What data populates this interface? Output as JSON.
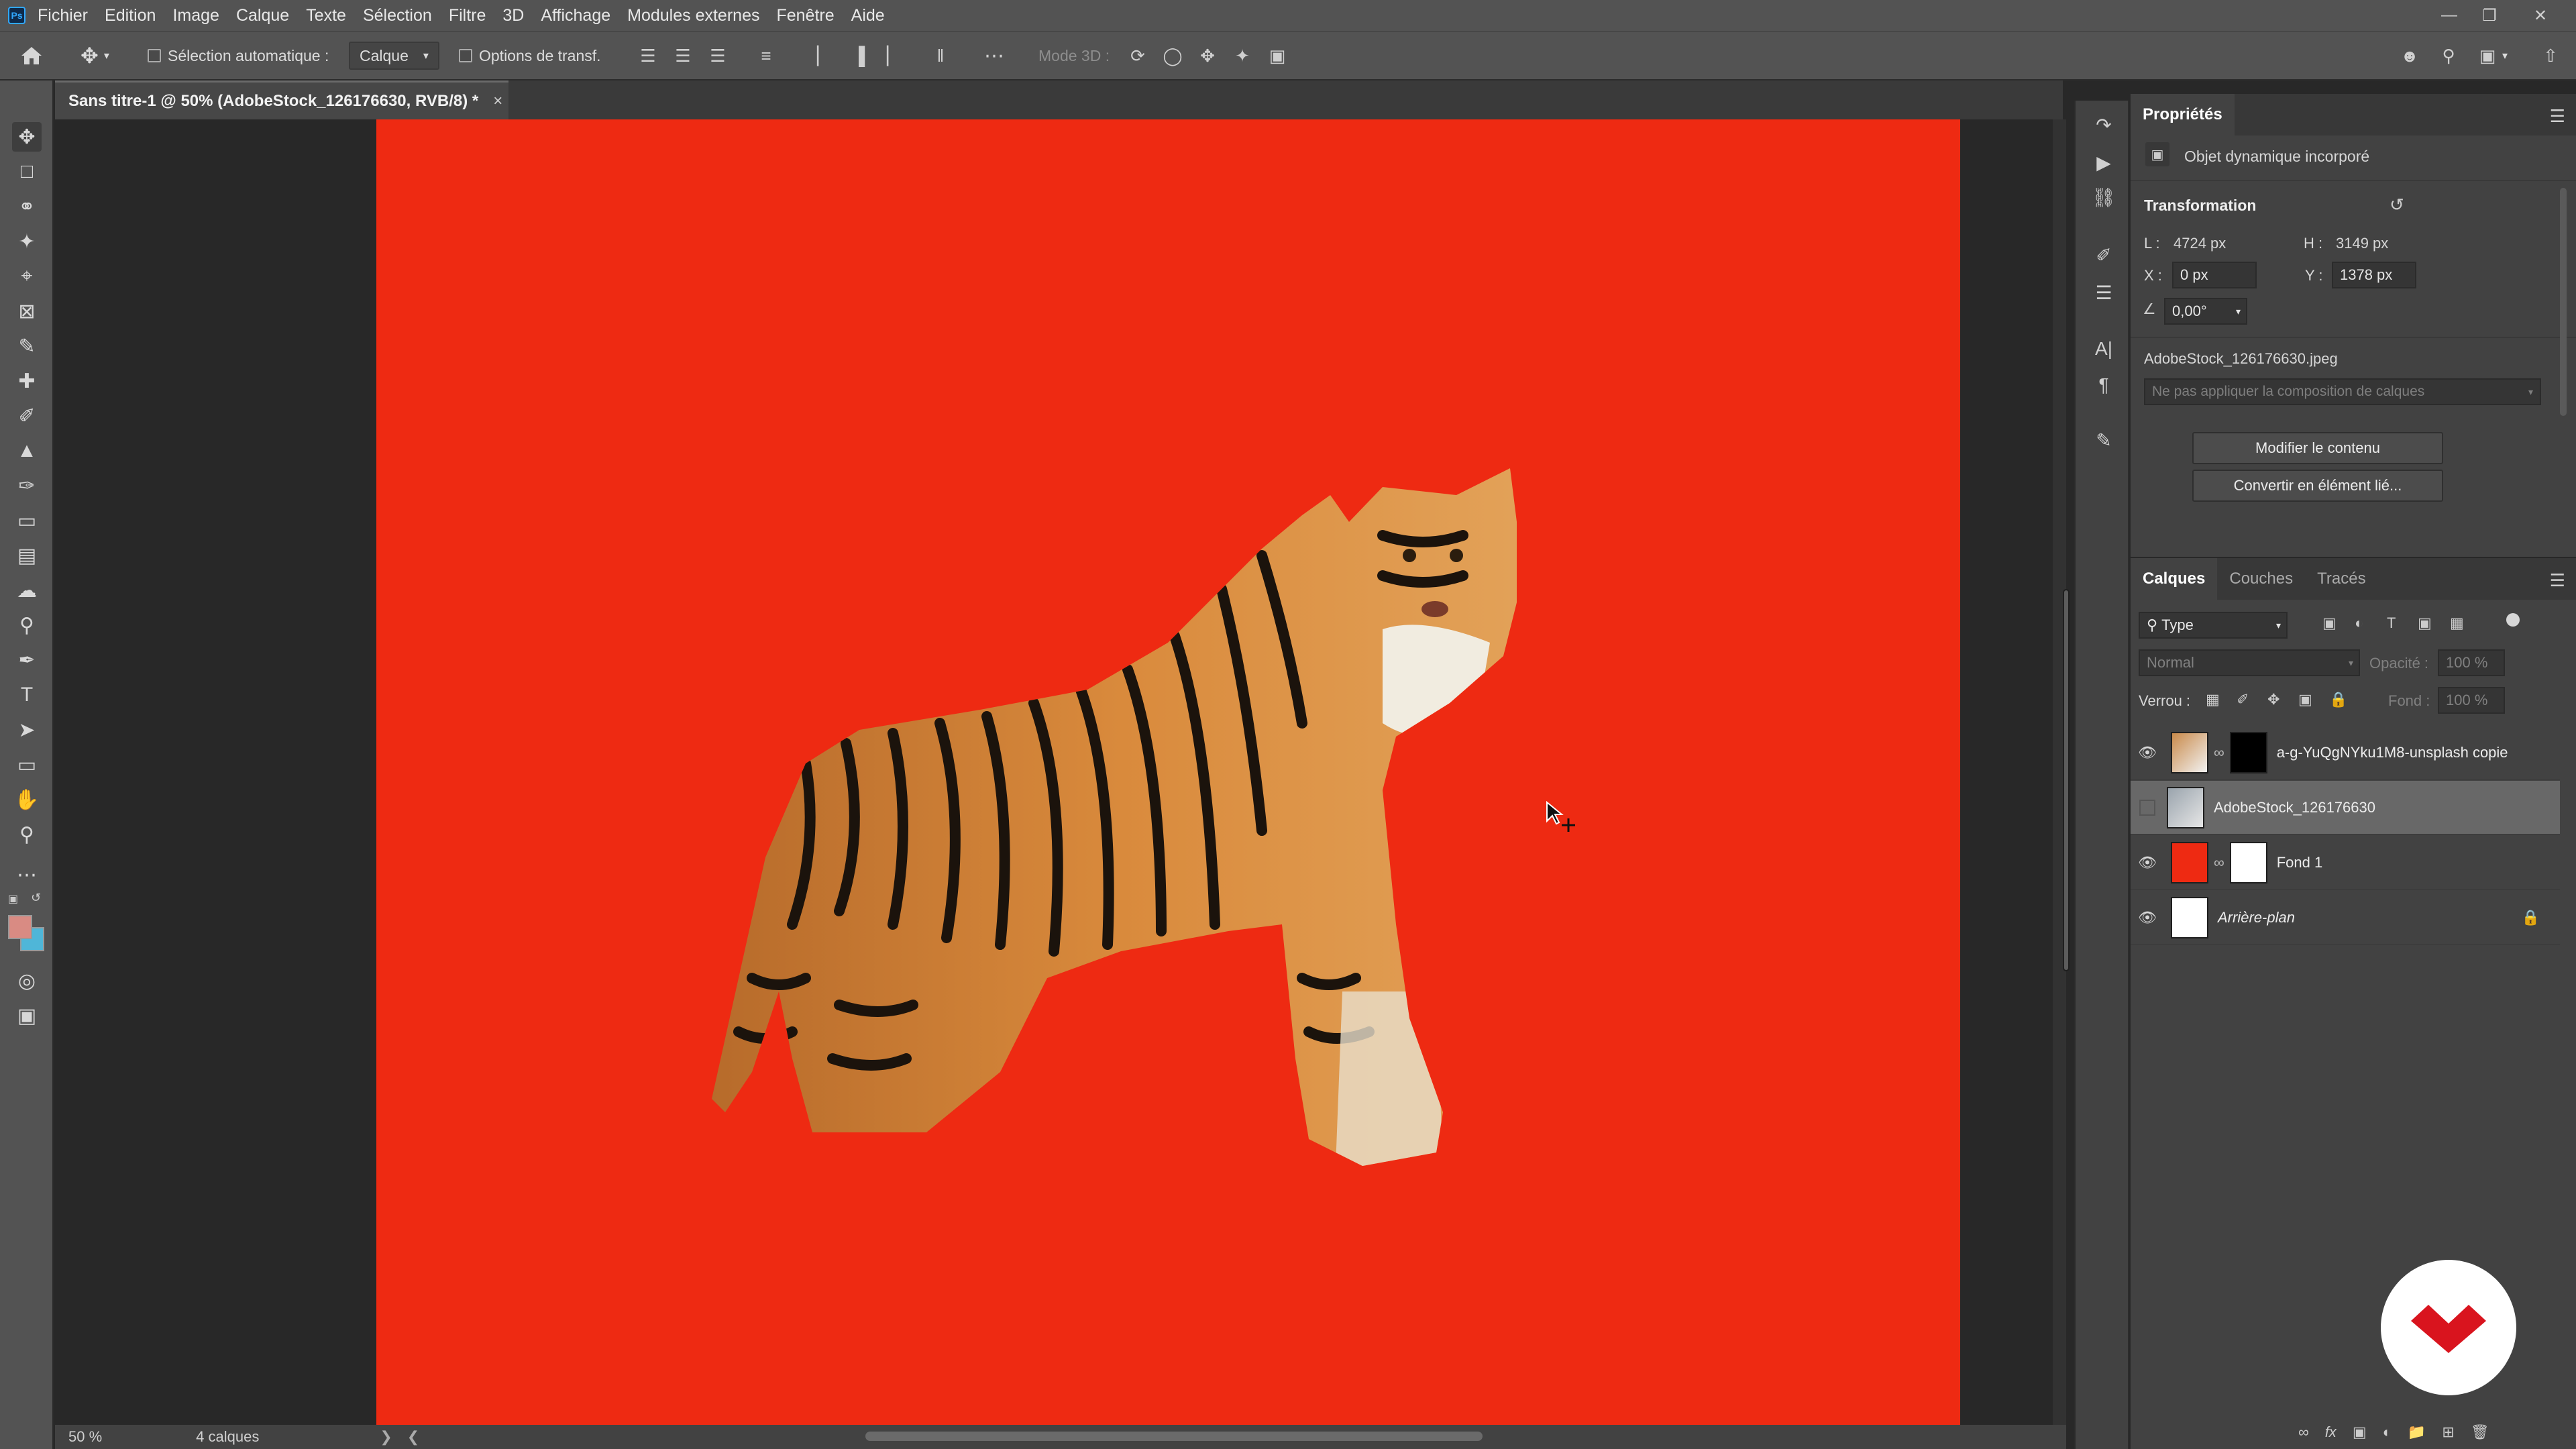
{
  "menubar": {
    "items": [
      "Fichier",
      "Edition",
      "Image",
      "Calque",
      "Texte",
      "Sélection",
      "Filtre",
      "3D",
      "Affichage",
      "Modules externes",
      "Fenêtre",
      "Aide"
    ]
  },
  "options": {
    "auto_select_label": "Sélection automatique :",
    "layer_dropdown": "Calque",
    "transform_options_label": "Options de transf.",
    "mode3d_label": "Mode 3D :"
  },
  "document": {
    "tab_title": "Sans titre-1 @ 50% (AdobeStock_126176630, RVB/8) *",
    "close_glyph": "×",
    "zoom": "50 %",
    "layer_count": "4 calques",
    "canvas_color": "#ee2a12"
  },
  "properties": {
    "tab_label": "Propriétés",
    "object_type": "Objet dynamique incorporé",
    "section_title": "Transformation",
    "width_label": "L :",
    "width_value": "4724 px",
    "height_label": "H :",
    "height_value": "3149 px",
    "x_label": "X :",
    "x_value": "0 px",
    "y_label": "Y :",
    "y_value": "1378 px",
    "angle_value": "0,00°",
    "source_file": "AdobeStock_126176630.jpeg",
    "comp_dropdown": "Ne pas appliquer la composition de calques",
    "edit_contents_button": "Modifier le contenu",
    "convert_linked_button": "Convertir en élément lié..."
  },
  "layers_panel": {
    "tabs": [
      "Calques",
      "Couches",
      "Tracés"
    ],
    "filter_dropdown": "Type",
    "blend_mode": "Normal",
    "opacity_label": "Opacité :",
    "opacity_value": "100 %",
    "lock_label": "Verrou :",
    "fill_label": "Fond :",
    "fill_value": "100 %",
    "layers": [
      {
        "name": "a-g-YuQgNYku1M8-unsplash copie",
        "visible": true
      },
      {
        "name": "AdobeStock_126176630",
        "visible": false,
        "selected": true
      },
      {
        "name": "Fond 1",
        "visible": true
      },
      {
        "name": "Arrière-plan",
        "visible": true,
        "locked": true
      }
    ]
  },
  "colors": {
    "accent_red": "#ee2a12",
    "foreground_swatch": "#d98b83",
    "background_swatch": "#4fb6d8",
    "brand_red": "#d9141e"
  }
}
